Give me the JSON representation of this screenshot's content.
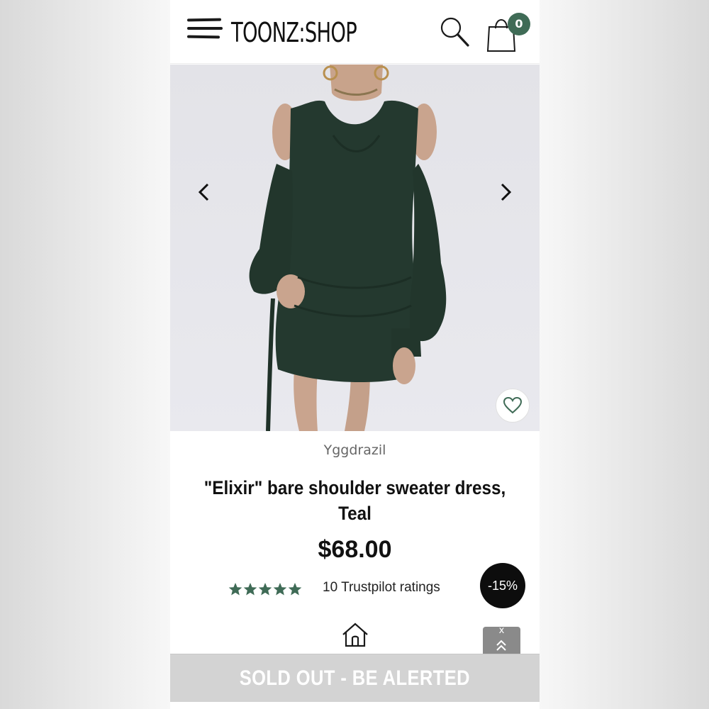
{
  "header": {
    "logo_text": "TOONZ:SHOP",
    "cart_count": "0"
  },
  "product": {
    "brand": "Yggdrazil",
    "title": "\"Elixir\" bare shoulder sweater dress, Teal",
    "price": "$68.00",
    "rating_stars": 5,
    "ratings_text": "10 Trustpilot ratings",
    "discount": "-15%"
  },
  "scroll_top": {
    "close_label": "x"
  },
  "cta": {
    "sold_out_label": "SOLD OUT - BE ALERTED"
  },
  "colors": {
    "accent": "#3f6b56",
    "dress": "#24392f",
    "star": "#3f6b56",
    "sold_out_bg": "#d3d3d3"
  },
  "icons": [
    "hamburger-icon",
    "search-icon",
    "shopping-bag-icon",
    "chevron-left-icon",
    "chevron-right-icon",
    "heart-icon",
    "star-icon",
    "home-icon",
    "double-chevron-up-icon"
  ]
}
